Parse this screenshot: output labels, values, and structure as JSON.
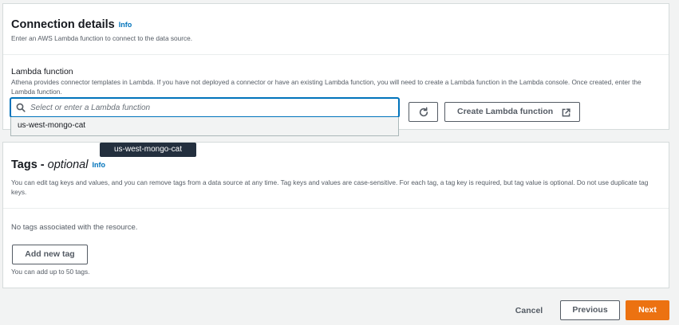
{
  "connection": {
    "title": "Connection details",
    "info": "Info",
    "description": "Enter an AWS Lambda function to connect to the data source.",
    "lambda_label": "Lambda function",
    "lambda_description": "Athena provides connector templates in Lambda. If you have not deployed a connector or have an existing Lambda function, you will need to create a Lambda function in the Lambda console. Once created, enter the Lambda function.",
    "lambda_placeholder": "Select or enter a Lambda function",
    "lambda_value": "",
    "dropdown_options": [
      "us-west-mongo-cat"
    ],
    "tooltip": "us-west-mongo-cat",
    "create_button": "Create Lambda function"
  },
  "tags": {
    "title": "Tags",
    "title_separator": " - ",
    "optional": "optional",
    "info": "Info",
    "description": "You can edit tag keys and values, and you can remove tags from a data source at any time. Tag keys and values are case-sensitive. For each tag, a tag key is required, but tag value is optional. Do not use duplicate tag keys.",
    "empty_message": "No tags associated with the resource.",
    "add_button": "Add new tag",
    "limit_text": "You can add up to 50 tags."
  },
  "footer": {
    "cancel": "Cancel",
    "previous": "Previous",
    "next": "Next"
  },
  "colors": {
    "primary": "#ec7211",
    "link": "#0073bb",
    "focus": "#0073bb",
    "tooltip_bg": "#232f3e"
  }
}
